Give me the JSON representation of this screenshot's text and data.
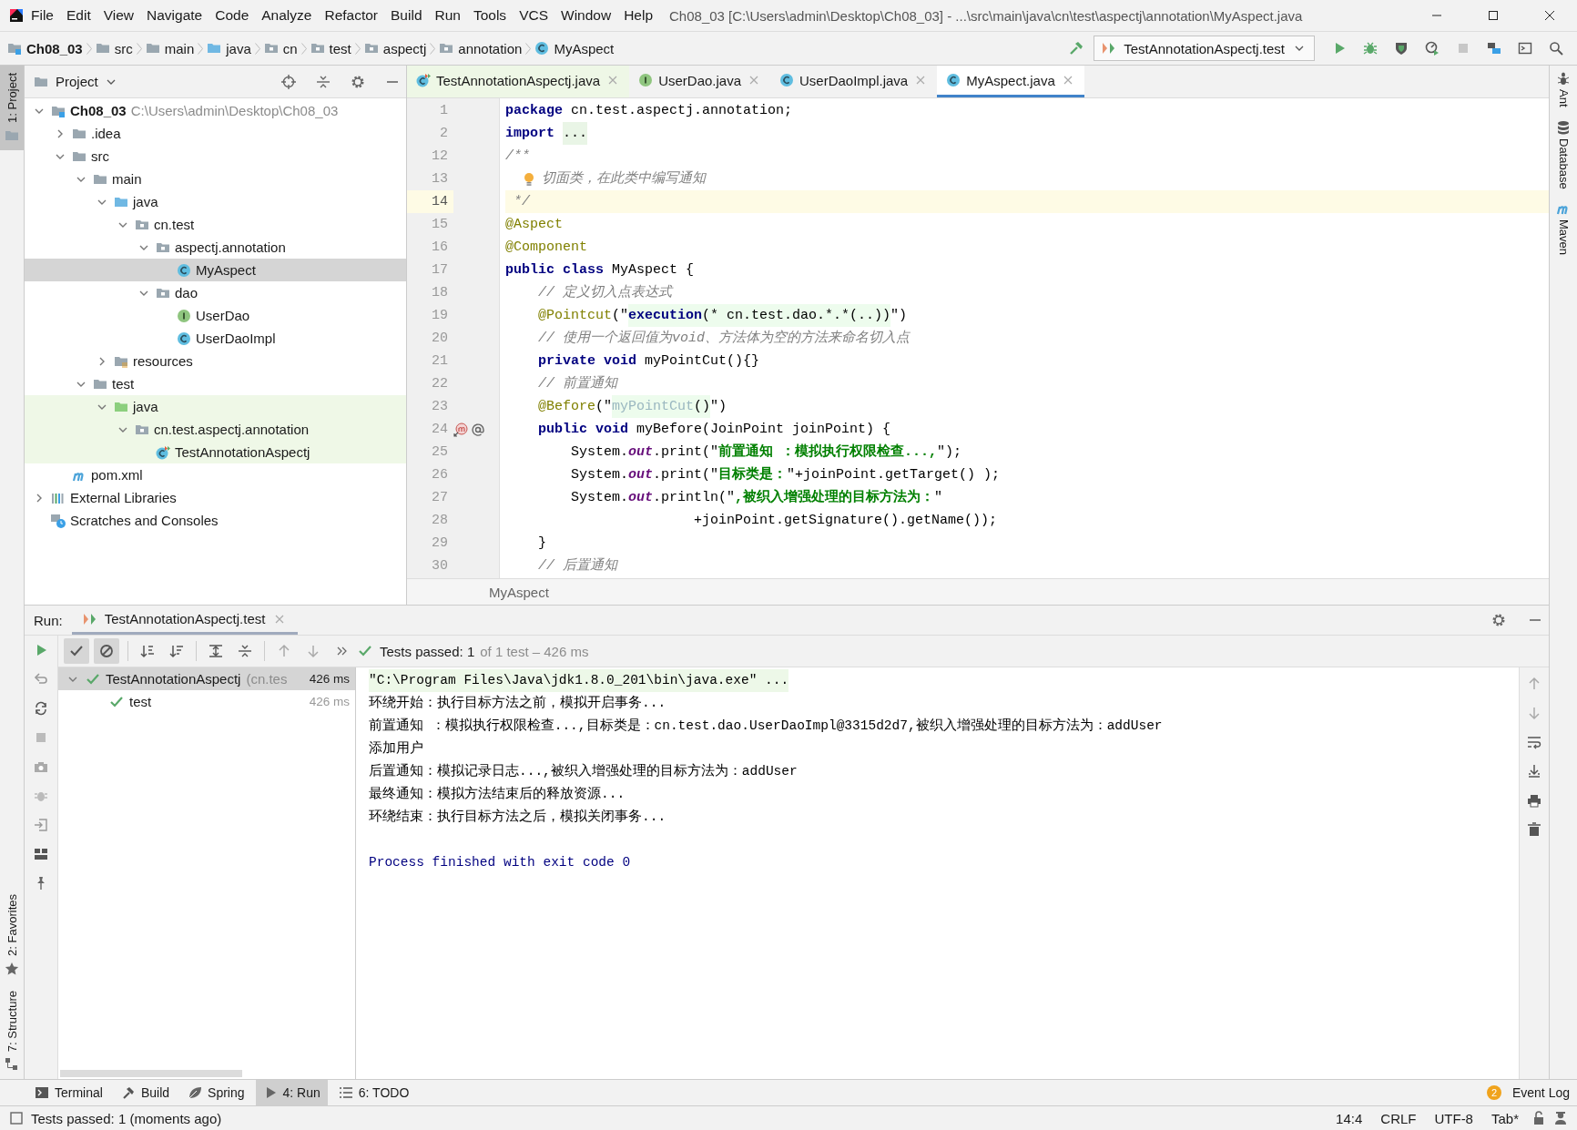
{
  "menu_bar": {
    "items": [
      "File",
      "Edit",
      "View",
      "Navigate",
      "Code",
      "Analyze",
      "Refactor",
      "Build",
      "Run",
      "Tools",
      "VCS",
      "Window",
      "Help"
    ],
    "title": "Ch08_03 [C:\\Users\\admin\\Desktop\\Ch08_03] - ...\\src\\main\\java\\cn\\test\\aspectj\\annotation\\MyAspect.java"
  },
  "breadcrumbs": [
    {
      "label": "Ch08_03",
      "kind": "project"
    },
    {
      "label": "src",
      "kind": "folder"
    },
    {
      "label": "main",
      "kind": "folder"
    },
    {
      "label": "java",
      "kind": "source"
    },
    {
      "label": "cn",
      "kind": "package"
    },
    {
      "label": "test",
      "kind": "package"
    },
    {
      "label": "aspectj",
      "kind": "package"
    },
    {
      "label": "annotation",
      "kind": "package"
    },
    {
      "label": "MyAspect",
      "kind": "class"
    }
  ],
  "run_config": {
    "label": "TestAnnotationAspectj.test"
  },
  "left_tool_tabs": {
    "top": [
      {
        "label": "1: Project",
        "kind": "project",
        "selected": true
      }
    ],
    "bottom": [
      {
        "label": "2: Favorites",
        "kind": "favorites",
        "selected": false
      },
      {
        "label": "7: Structure",
        "kind": "structure",
        "selected": false
      }
    ]
  },
  "right_tool_tabs": [
    {
      "label": "Ant",
      "kind": "ant"
    },
    {
      "label": "Database",
      "kind": "database"
    },
    {
      "label": "Maven",
      "kind": "maven"
    }
  ],
  "project_panel": {
    "title": "Project",
    "tree": [
      {
        "label": "Ch08_03",
        "path": "C:\\Users\\admin\\Desktop\\Ch08_03",
        "kind": "project",
        "expanded": true,
        "selected": false,
        "children": [
          {
            "label": ".idea",
            "kind": "folder",
            "expanded": false,
            "selected": false
          },
          {
            "label": "src",
            "kind": "folder",
            "expanded": true,
            "selected": false,
            "children": [
              {
                "label": "main",
                "kind": "folder",
                "expanded": true,
                "selected": false,
                "children": [
                  {
                    "label": "java",
                    "kind": "source",
                    "expanded": true,
                    "selected": false,
                    "children": [
                      {
                        "label": "cn.test",
                        "kind": "package",
                        "expanded": true,
                        "selected": false,
                        "children": [
                          {
                            "label": "aspectj.annotation",
                            "kind": "package",
                            "expanded": true,
                            "selected": false,
                            "children": [
                              {
                                "label": "MyAspect",
                                "kind": "class",
                                "selected": true
                              }
                            ]
                          },
                          {
                            "label": "dao",
                            "kind": "package",
                            "expanded": true,
                            "selected": false,
                            "children": [
                              {
                                "label": "UserDao",
                                "kind": "interface",
                                "selected": false
                              },
                              {
                                "label": "UserDaoImpl",
                                "kind": "class",
                                "selected": false
                              }
                            ]
                          }
                        ]
                      }
                    ]
                  },
                  {
                    "label": "resources",
                    "kind": "resources",
                    "expanded": false,
                    "selected": false
                  }
                ]
              },
              {
                "label": "test",
                "kind": "folder",
                "expanded": true,
                "selected": false,
                "children": [
                  {
                    "label": "java",
                    "kind": "test_source",
                    "expanded": true,
                    "selected": false,
                    "children": [
                      {
                        "label": "cn.test.aspectj.annotation",
                        "kind": "package",
                        "expanded": true,
                        "selected": false,
                        "children": [
                          {
                            "label": "TestAnnotationAspectj",
                            "kind": "test_class",
                            "selected": false
                          }
                        ]
                      }
                    ]
                  }
                ]
              }
            ]
          },
          {
            "label": "pom.xml",
            "kind": "maven",
            "selected": false
          }
        ]
      },
      {
        "label": "External Libraries",
        "kind": "libraries",
        "expanded": false,
        "selected": false
      },
      {
        "label": "Scratches and Consoles",
        "kind": "scratches",
        "selected": false
      }
    ]
  },
  "editor": {
    "tabs": [
      {
        "label": "TestAnnotationAspectj.java",
        "kind": "test_class",
        "selected": false
      },
      {
        "label": "UserDao.java",
        "kind": "interface",
        "selected": false
      },
      {
        "label": "UserDaoImpl.java",
        "kind": "class",
        "selected": false
      },
      {
        "label": "MyAspect.java",
        "kind": "class",
        "selected": true
      }
    ],
    "lines": [
      {
        "number": "1",
        "current": false,
        "tokens": [
          {
            "kind": "keyword",
            "text": "package"
          },
          {
            "kind": "plain",
            "text": " cn.test.aspectj.annotation;"
          }
        ]
      },
      {
        "number": "2",
        "current": false,
        "tokens": [
          {
            "kind": "keyword",
            "text": "import"
          },
          {
            "kind": "folded",
            "text": "..."
          }
        ]
      },
      {
        "number": "12",
        "current": false,
        "tokens": [
          {
            "kind": "comment",
            "text": "/**"
          }
        ]
      },
      {
        "number": "13",
        "current": false,
        "bulb": true,
        "tokens": [
          {
            "kind": "comment",
            "text": "切面类，在此类中编写通知"
          }
        ]
      },
      {
        "number": "14",
        "current": true,
        "tokens": [
          {
            "kind": "comment",
            "text": " */"
          }
        ]
      },
      {
        "number": "15",
        "current": false,
        "tokens": [
          {
            "kind": "annotation",
            "text": "@Aspect"
          }
        ]
      },
      {
        "number": "16",
        "current": false,
        "tokens": [
          {
            "kind": "annotation",
            "text": "@Component"
          }
        ]
      },
      {
        "number": "17",
        "current": false,
        "tokens": [
          {
            "kind": "keyword",
            "text": "public class"
          },
          {
            "kind": "plain",
            "text": " MyAspect {"
          }
        ]
      },
      {
        "number": "18",
        "current": false,
        "tokens": [
          {
            "kind": "comment",
            "text": "    // 定义切入点表达式"
          }
        ]
      },
      {
        "number": "19",
        "current": false,
        "tokens": [
          {
            "kind": "annotation",
            "text": "    @Pointcut"
          },
          {
            "kind": "plain",
            "text": "(\""
          },
          {
            "kind": "injected_keyword",
            "text": "execution"
          },
          {
            "kind": "injected",
            "text": "(* cn.test.dao.*.*(..))"
          },
          {
            "kind": "plain",
            "text": "\")"
          }
        ]
      },
      {
        "number": "20",
        "current": false,
        "tokens": [
          {
            "kind": "comment",
            "text": "    // 使用一个返回值为void、方法体为空的方法来命名切入点"
          }
        ]
      },
      {
        "number": "21",
        "current": false,
        "tokens": [
          {
            "kind": "keyword",
            "text": "    private void"
          },
          {
            "kind": "plain",
            "text": " myPointCut(){}"
          }
        ]
      },
      {
        "number": "22",
        "current": false,
        "tokens": [
          {
            "kind": "comment",
            "text": "    // 前置通知"
          }
        ]
      },
      {
        "number": "23",
        "current": false,
        "tokens": [
          {
            "kind": "annotation",
            "text": "    @Before"
          },
          {
            "kind": "plain",
            "text": "(\""
          },
          {
            "kind": "injected_ref",
            "text": "myPointCut"
          },
          {
            "kind": "injected",
            "text": "()"
          },
          {
            "kind": "plain",
            "text": "\")"
          }
        ]
      },
      {
        "number": "24",
        "current": false,
        "gutter_markers": true,
        "tokens": [
          {
            "kind": "keyword",
            "text": "    public void"
          },
          {
            "kind": "plain",
            "text": " myBefore(JoinPoint joinPoint) {"
          }
        ]
      },
      {
        "number": "25",
        "current": false,
        "tokens": [
          {
            "kind": "plain",
            "text": "        System."
          },
          {
            "kind": "static",
            "text": "out"
          },
          {
            "kind": "plain",
            "text": ".print(\""
          },
          {
            "kind": "string",
            "text": "前置通知 ：模拟执行权限检查...,"
          },
          {
            "kind": "plain",
            "text": "\");"
          }
        ]
      },
      {
        "number": "26",
        "current": false,
        "tokens": [
          {
            "kind": "plain",
            "text": "        System."
          },
          {
            "kind": "static",
            "text": "out"
          },
          {
            "kind": "plain",
            "text": ".print(\""
          },
          {
            "kind": "string",
            "text": "目标类是："
          },
          {
            "kind": "plain",
            "text": "\"+joinPoint.getTarget() );"
          }
        ]
      },
      {
        "number": "27",
        "current": false,
        "tokens": [
          {
            "kind": "plain",
            "text": "        System."
          },
          {
            "kind": "static",
            "text": "out"
          },
          {
            "kind": "plain",
            "text": ".println(\""
          },
          {
            "kind": "string",
            "text": ",被织入增强处理的目标方法为："
          },
          {
            "kind": "plain",
            "text": "\""
          }
        ]
      },
      {
        "number": "28",
        "current": false,
        "tokens": [
          {
            "kind": "plain",
            "text": "                       +joinPoint.getSignature().getName());"
          }
        ]
      },
      {
        "number": "29",
        "current": false,
        "tokens": [
          {
            "kind": "plain",
            "text": "    }"
          }
        ]
      },
      {
        "number": "30",
        "current": false,
        "tokens": [
          {
            "kind": "comment",
            "text": "    // 后置通知"
          }
        ]
      }
    ],
    "breadcrumb": "MyAspect"
  },
  "run_panel": {
    "label": "Run:",
    "tab": {
      "label": "TestAnnotationAspectj.test",
      "selected": true
    },
    "summary": {
      "status": "Tests passed: 1",
      "detail": "of 1 test – 426 ms"
    },
    "tests": [
      {
        "label": "TestAnnotationAspectj",
        "detail": "(cn.tes",
        "time": "426 ms",
        "passed": true,
        "selected": true,
        "expanded": true,
        "children": [
          {
            "label": "test",
            "time": "426 ms",
            "passed": true,
            "selected": false
          }
        ]
      }
    ],
    "console": [
      {
        "kind": "command",
        "text": "\"C:\\Program Files\\Java\\jdk1.8.0_201\\bin\\java.exe\" ..."
      },
      {
        "kind": "output",
        "text": "环绕开始：执行目标方法之前，模拟开启事务..."
      },
      {
        "kind": "output",
        "text": "前置通知 ：模拟执行权限检查...,目标类是：cn.test.dao.UserDaoImpl@3315d2d7,被织入增强处理的目标方法为：addUser"
      },
      {
        "kind": "output",
        "text": "添加用户"
      },
      {
        "kind": "output",
        "text": "后置通知：模拟记录日志...,被织入增强处理的目标方法为：addUser"
      },
      {
        "kind": "output",
        "text": "最终通知：模拟方法结束后的释放资源..."
      },
      {
        "kind": "output",
        "text": "环绕结束：执行目标方法之后，模拟关闭事务..."
      },
      {
        "kind": "system",
        "text": "Process finished with exit code 0"
      }
    ]
  },
  "tool_tabs": [
    {
      "label": "Terminal",
      "kind": "terminal",
      "selected": false
    },
    {
      "label": "Build",
      "kind": "build",
      "selected": false
    },
    {
      "label": "Spring",
      "kind": "spring",
      "selected": false
    },
    {
      "label": "4: Run",
      "kind": "run",
      "selected": true
    },
    {
      "label": "6: TODO",
      "kind": "todo",
      "selected": false
    }
  ],
  "event_log": {
    "label": "Event Log",
    "count": "2"
  },
  "status_bar": {
    "message": "Tests passed: 1 (moments ago)",
    "items": [
      "14:4",
      "CRLF",
      "UTF-8",
      "Tab*"
    ]
  }
}
